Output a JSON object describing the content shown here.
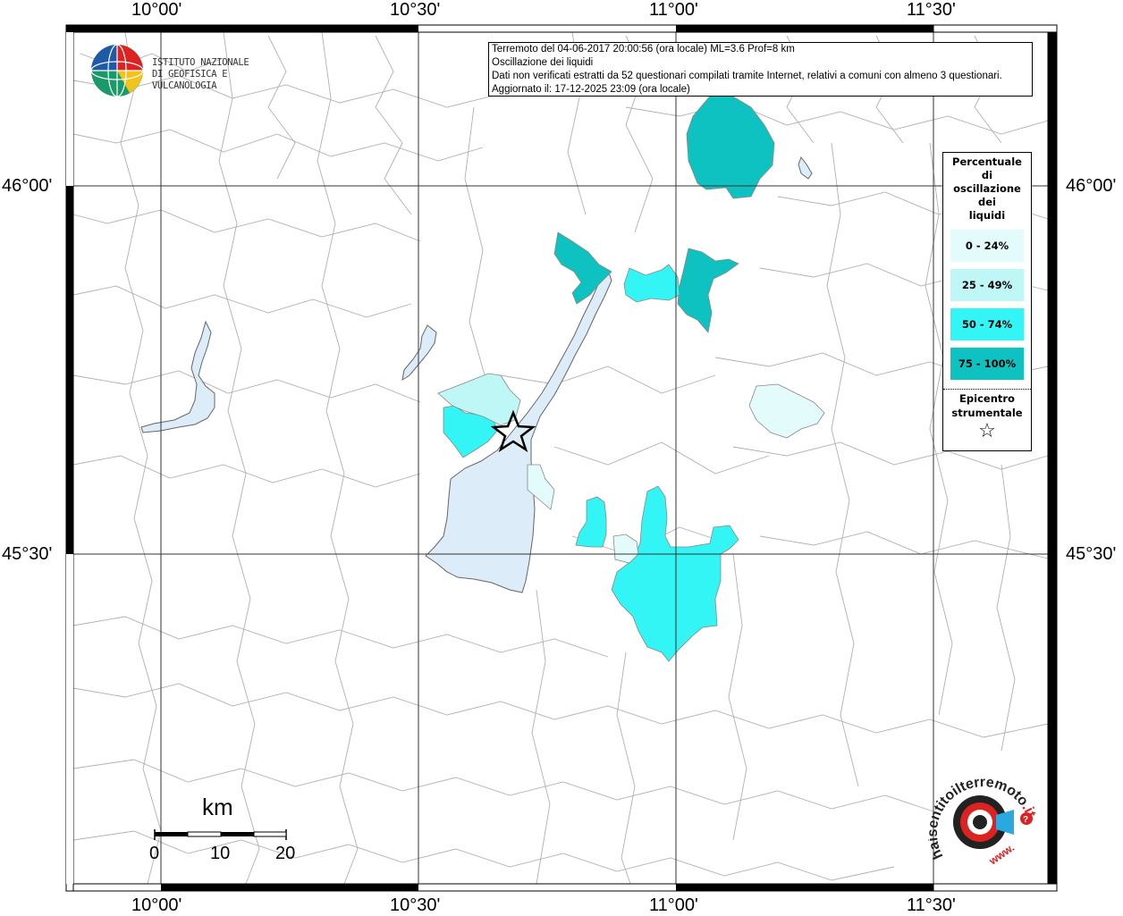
{
  "map": {
    "lon_labels": [
      "10°00'",
      "10°30'",
      "11°00'",
      "11°30'"
    ],
    "lat_labels": [
      "46°00'",
      "45°30'"
    ]
  },
  "info": {
    "line1": "Terremoto del 04-06-2017 20:00:56 (ora locale) ML=3.6 Prof=8 km",
    "line2": "Oscillazione dei liquidi",
    "line3": "Dati non verificati estratti da 52 questionari compilati tramite Internet, relativi a comuni con almeno 3 questionari.",
    "line4": "Aggiornato il: 17-12-2025 23:09 (ora locale)"
  },
  "logo_ingv": {
    "line1": "ISTITUTO NAZIONALE",
    "line2": "DI GEOFISICA E VULCANOLOGIA"
  },
  "legend": {
    "title_lines": [
      "Percentuale",
      "di",
      "oscillazione",
      "dei",
      "liquidi"
    ],
    "items": [
      {
        "label": "0 - 24%",
        "color": "#e4fbfb"
      },
      {
        "label": "25 - 49%",
        "color": "#bff7f7"
      },
      {
        "label": "50 - 74%",
        "color": "#33f5f5"
      },
      {
        "label": "75 - 100%",
        "color": "#0fc2c2"
      }
    ],
    "epicenter_lines": [
      "Epicentro",
      "strumentale"
    ],
    "epicenter_symbol": "☆"
  },
  "scale": {
    "unit": "km",
    "ticks": [
      "0",
      "10",
      "20"
    ]
  },
  "logo_hst": {
    "text_main": "haisentitoilterremoto",
    "text_suffix": ".it",
    "text_www": "www."
  },
  "colors": {
    "lake": "#dcecf8",
    "border": "#9a9a9a",
    "grid": "#333333"
  }
}
